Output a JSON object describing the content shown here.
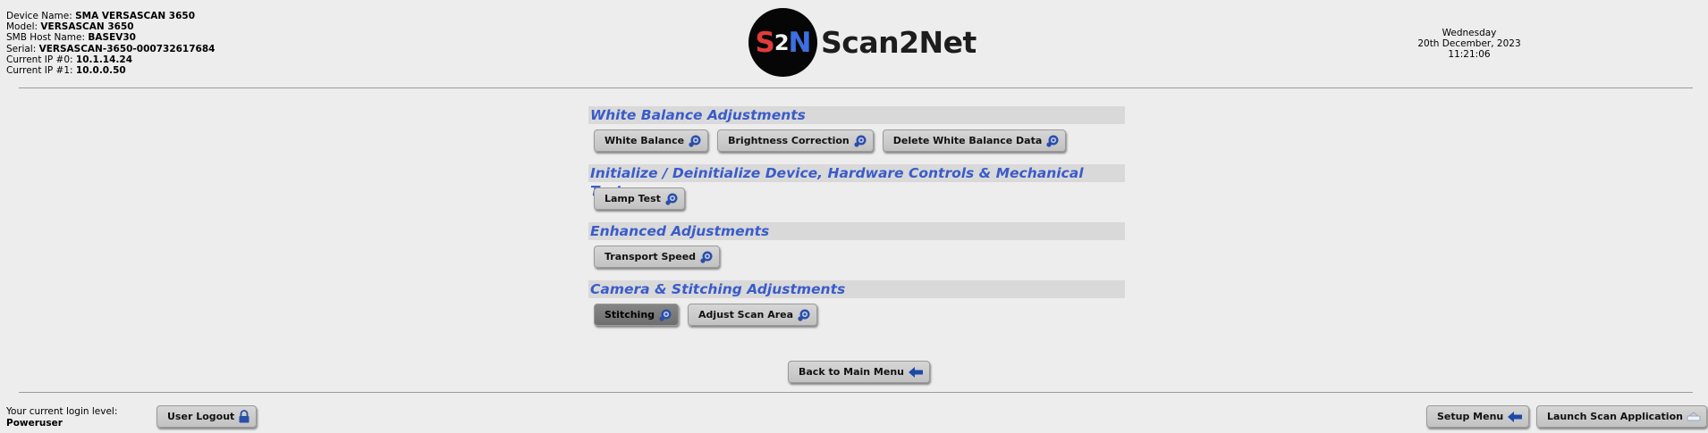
{
  "device": {
    "name_label": "Device Name:",
    "name": "SMA VERSASCAN 3650",
    "model_label": "Model:",
    "model": "VERSASCAN 3650",
    "smb_label": "SMB Host Name:",
    "smb": "BASEV30",
    "serial_label": "Serial:",
    "serial": "VERSASCAN-3650-000732617684",
    "ip0_label": "Current IP #0:",
    "ip0": "10.1.14.24",
    "ip1_label": "Current IP #1:",
    "ip1": "10.0.0.50"
  },
  "logo": {
    "mark_s": "S",
    "mark_2": "2",
    "mark_n": "N",
    "text": "Scan2Net"
  },
  "datetime": {
    "day": "Wednesday",
    "date": "20th December, 2023",
    "time": "11:21:06"
  },
  "sections": [
    {
      "title": "White Balance Adjustments",
      "buttons": [
        "White Balance",
        "Brightness Correction",
        "Delete White Balance Data"
      ]
    },
    {
      "title": "Initialize / Deinitialize Device, Hardware Controls & Mechanical Tests",
      "buttons": [
        "Lamp Test"
      ]
    },
    {
      "title": "Enhanced Adjustments",
      "buttons": [
        "Transport Speed"
      ]
    },
    {
      "title": "Camera & Stitching Adjustments",
      "buttons": [
        "Stitching",
        "Adjust Scan Area"
      ]
    }
  ],
  "back_button": "Back to Main Menu",
  "login": {
    "label": "Your current login level:",
    "level": "Poweruser"
  },
  "logout_button": "User Logout",
  "setup_button": "Setup Menu",
  "launch_button": "Launch Scan Application",
  "colors": {
    "section_title": "#3a5cc9",
    "section_bg": "#d9d9d9",
    "active_button": "#7a7a7a",
    "icon_blue": "#2a4fa8"
  }
}
